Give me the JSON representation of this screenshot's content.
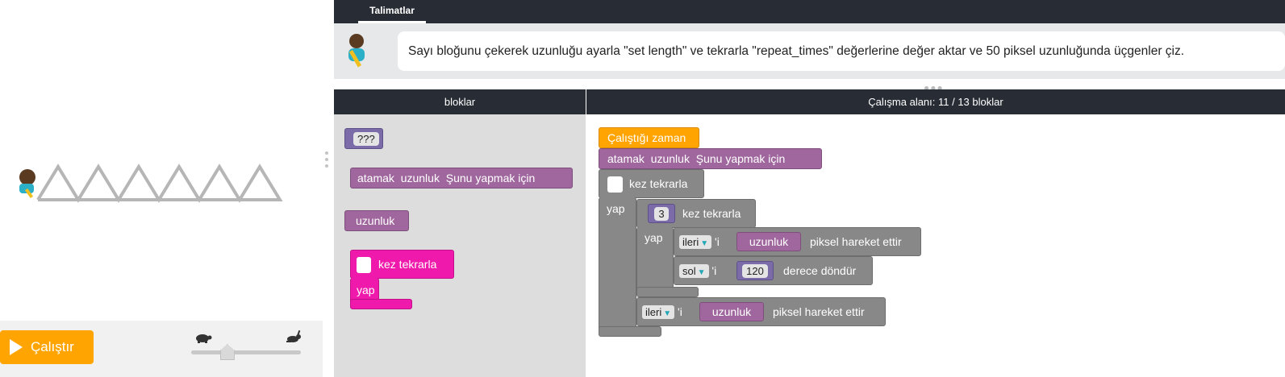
{
  "instructions": {
    "tab_label": "Talimatlar",
    "text": "Sayı bloğunu çekerek uzunluğu ayarla \"set length\" ve tekrarla \"repeat_times\" değerlerine değer aktar ve 50 piksel uzunluğunda üçgenler çiz."
  },
  "controls": {
    "run_label": "Çalıştır",
    "speed": 0.33
  },
  "toolbox": {
    "header": "bloklar",
    "unknown_block": "???",
    "set_block": {
      "a": "atamak",
      "b": "uzunluk",
      "c": "Şunu yapmak için"
    },
    "var_block": "uzunluk",
    "repeat_block": {
      "label": "kez tekrarla",
      "do": "yap"
    }
  },
  "workspace": {
    "header": "Çalışma alanı: 11 / 13 bloklar",
    "when_run": "Çalıştığı zaman",
    "set": {
      "a": "atamak",
      "b": "uzunluk",
      "c": "Şunu yapmak için"
    },
    "outer_repeat": {
      "label": "kez tekrarla",
      "do": "yap"
    },
    "inner_repeat": {
      "count": "3",
      "label": "kez tekrarla",
      "do": "yap"
    },
    "move1": {
      "dir": "ileri",
      "suffix": "'i",
      "var": "uzunluk",
      "label": "piksel hareket ettir"
    },
    "turn": {
      "dir": "sol",
      "suffix": "'i",
      "value": "120",
      "label": "derece döndür"
    },
    "move2": {
      "dir": "ileri",
      "suffix": "'i",
      "var": "uzunluk",
      "label": "piksel hareket ettir"
    }
  },
  "colors": {
    "run": "#ffa400",
    "variable": "#a0679e",
    "math": "#7b6ba8",
    "loop_pink": "#ef19ab",
    "draw": "#888888",
    "header": "#282c34"
  }
}
